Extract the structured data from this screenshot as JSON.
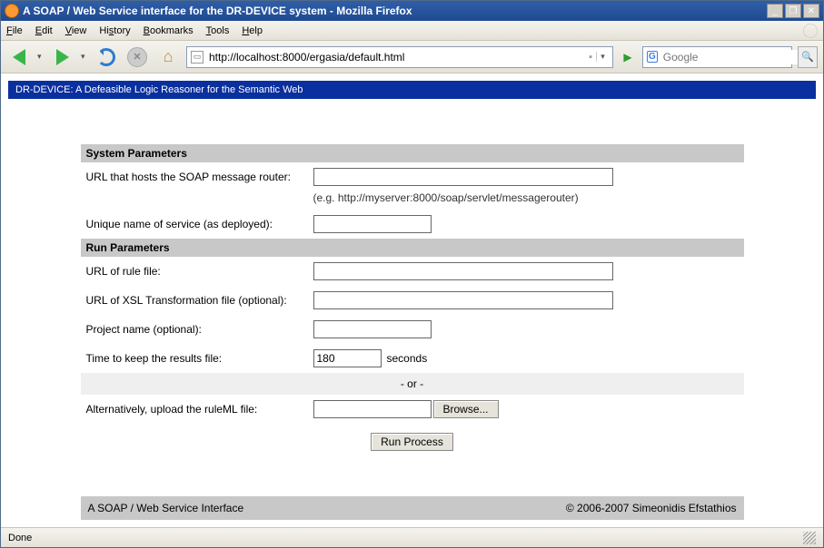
{
  "window": {
    "title": "A SOAP / Web Service interface for the DR-DEVICE system - Mozilla Firefox"
  },
  "menu": {
    "file": "File",
    "edit": "Edit",
    "view": "View",
    "history": "History",
    "bookmarks": "Bookmarks",
    "tools": "Tools",
    "help": "Help"
  },
  "toolbar": {
    "url": "http://localhost:8000/ergasia/default.html",
    "search_placeholder": "Google"
  },
  "page": {
    "banner": "DR-DEVICE: A Defeasible Logic Reasoner for the Semantic Web",
    "sections": {
      "system": "System Parameters",
      "run": "Run Parameters"
    },
    "labels": {
      "soap_url": "URL that hosts the SOAP message router:",
      "soap_hint": "(e.g. http://myserver:8000/soap/servlet/messagerouter)",
      "service_name": "Unique name of service (as deployed):",
      "rule_url": "URL of rule file:",
      "xsl_url": "URL of XSL Transformation file (optional):",
      "project": "Project name (optional):",
      "ttl": "Time to keep the results file:",
      "ttl_unit": "seconds",
      "or": "- or -",
      "upload": "Alternatively, upload the ruleML file:",
      "browse": "Browse...",
      "run": "Run Process"
    },
    "values": {
      "soap_url": "",
      "service_name": "",
      "rule_url": "",
      "xsl_url": "",
      "project": "",
      "ttl": "180",
      "upload": ""
    },
    "footer": {
      "left": "A SOAP / Web Service Interface",
      "right": "© 2006-2007 Simeonidis Efstathios"
    }
  },
  "status": {
    "text": "Done"
  }
}
